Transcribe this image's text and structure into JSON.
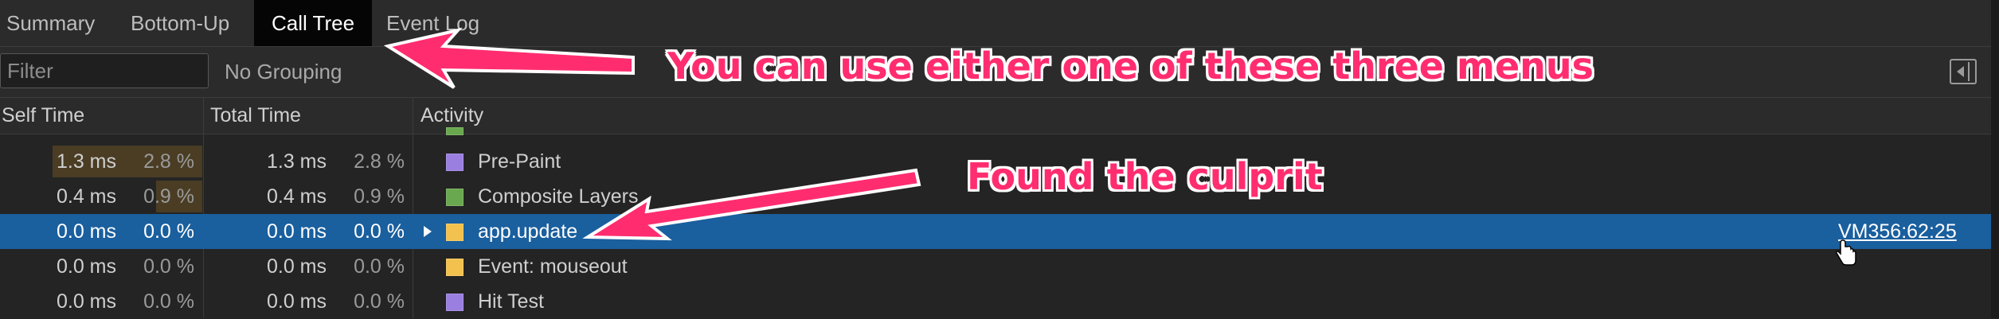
{
  "tabs": [
    {
      "label": "Summary",
      "active": false
    },
    {
      "label": "Bottom-Up",
      "active": false
    },
    {
      "label": "Call Tree",
      "active": true
    },
    {
      "label": "Event Log",
      "active": false
    }
  ],
  "toolbar": {
    "filter_placeholder": "Filter",
    "grouping": "No Grouping",
    "panel_toggle_icon": "sidebar-toggle-icon"
  },
  "columns": {
    "self_time": "Self Time",
    "total_time": "Total Time",
    "activity": "Activity"
  },
  "rows": [
    {
      "self_time": "1.3 ms",
      "self_pct": "2.8 %",
      "total_time": "1.3 ms",
      "total_pct": "2.8 %",
      "activity": "Pre-Paint",
      "color": "#9b7fe0",
      "expandable": false,
      "selected": false,
      "source": ""
    },
    {
      "self_time": "0.4 ms",
      "self_pct": "0.9 %",
      "total_time": "0.4 ms",
      "total_pct": "0.9 %",
      "activity": "Composite Layers",
      "color": "#6aa84f",
      "expandable": false,
      "selected": false,
      "source": ""
    },
    {
      "self_time": "0.0 ms",
      "self_pct": "0.0 %",
      "total_time": "0.0 ms",
      "total_pct": "0.0 %",
      "activity": "app.update",
      "color": "#f2c14e",
      "expandable": true,
      "selected": true,
      "source": "VM356:62:25"
    },
    {
      "self_time": "0.0 ms",
      "self_pct": "0.0 %",
      "total_time": "0.0 ms",
      "total_pct": "0.0 %",
      "activity": "Event: mouseout",
      "color": "#f2c14e",
      "expandable": false,
      "selected": false,
      "source": ""
    },
    {
      "self_time": "0.0 ms",
      "self_pct": "0.0 %",
      "total_time": "0.0 ms",
      "total_pct": "0.0 %",
      "activity": "Hit Test",
      "color": "#9b7fe0",
      "expandable": false,
      "selected": false,
      "source": ""
    }
  ],
  "annotations": {
    "menus_note": "You can use either one of these three menus",
    "culprit_note": "Found the culprit"
  },
  "colors": {
    "annotation": "#ff2d6f",
    "selection": "#1a5f9e",
    "paint_purple": "#9b7fe0",
    "composite_green": "#6aa84f",
    "script_yellow": "#f2c14e"
  }
}
